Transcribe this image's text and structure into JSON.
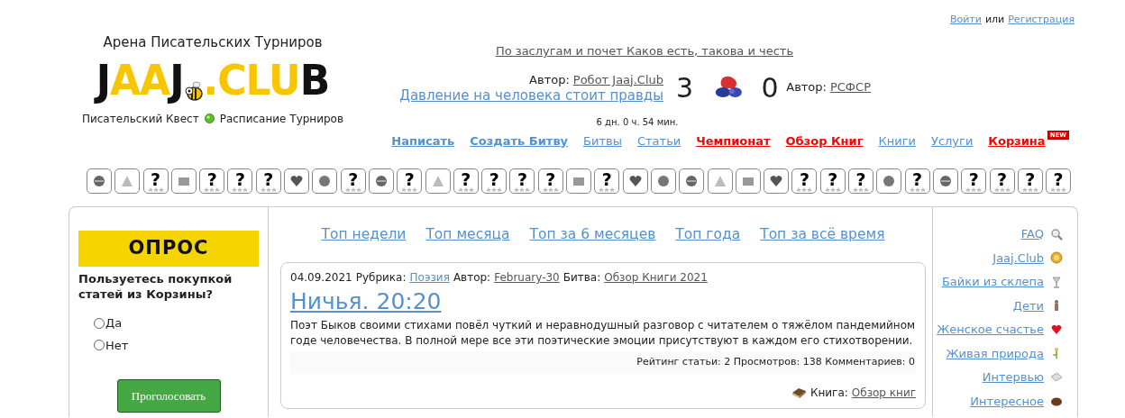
{
  "auth": {
    "login": "Войти",
    "separator": "или",
    "register": "Регистрация"
  },
  "site": {
    "tagline": "Арена Писательских Турниров",
    "logo": [
      {
        "text": "J",
        "color": "#111111"
      },
      {
        "text": "AA",
        "color": "#f7c600"
      },
      {
        "text": "J",
        "color": "#111111"
      },
      {
        "text": ".CLU",
        "color": "#f7c600"
      },
      {
        "text": "B",
        "color": "#111111"
      }
    ],
    "quest": "Писательский Квест",
    "schedule": "Расписание Турниров"
  },
  "battle": {
    "motto": "По заслугам и почет Каков есть, такова и честь",
    "left_author_label": "Автор:",
    "left_author": "Робот Jaaj.Club",
    "title": "Давление на человека стоит правды",
    "left_score": "3",
    "right_score": "0",
    "right_author_label": "Автор:",
    "right_author": "РСФСР",
    "timer": "6 дн. 0 ч. 54 мин."
  },
  "nav": [
    {
      "label": "Написать",
      "kind": "bold"
    },
    {
      "label": "Создать Битву",
      "kind": "bold"
    },
    {
      "label": "Битвы",
      "kind": "plain"
    },
    {
      "label": "Статьи",
      "kind": "plain"
    },
    {
      "label": "Чемпионат",
      "kind": "red"
    },
    {
      "label": "Обзор Книг",
      "kind": "red"
    },
    {
      "label": "Книги",
      "kind": "plain"
    },
    {
      "label": "Услуги",
      "kind": "plain"
    },
    {
      "label": "Корзина",
      "kind": "red",
      "badge": "NEW"
    }
  ],
  "badges": [
    {
      "kind": "item"
    },
    {
      "kind": "item"
    },
    {
      "kind": "unknown",
      "label": "?"
    },
    {
      "kind": "item"
    },
    {
      "kind": "unknown",
      "label": "?"
    },
    {
      "kind": "unknown",
      "label": "?"
    },
    {
      "kind": "unknown",
      "label": "?"
    },
    {
      "kind": "item"
    },
    {
      "kind": "item"
    },
    {
      "kind": "unknown",
      "label": "?"
    },
    {
      "kind": "item"
    },
    {
      "kind": "unknown",
      "label": "?"
    },
    {
      "kind": "item"
    },
    {
      "kind": "unknown",
      "label": "?"
    },
    {
      "kind": "unknown",
      "label": "?"
    },
    {
      "kind": "unknown",
      "label": "?"
    },
    {
      "kind": "unknown",
      "label": "?"
    },
    {
      "kind": "item"
    },
    {
      "kind": "unknown",
      "label": "?"
    },
    {
      "kind": "item"
    },
    {
      "kind": "item"
    },
    {
      "kind": "item"
    },
    {
      "kind": "item"
    },
    {
      "kind": "item"
    },
    {
      "kind": "item"
    },
    {
      "kind": "unknown",
      "label": "?"
    },
    {
      "kind": "unknown",
      "label": "?"
    },
    {
      "kind": "unknown",
      "label": "?"
    },
    {
      "kind": "item"
    },
    {
      "kind": "unknown",
      "label": "?"
    },
    {
      "kind": "item"
    },
    {
      "kind": "unknown",
      "label": "?"
    },
    {
      "kind": "unknown",
      "label": "?"
    },
    {
      "kind": "unknown",
      "label": "?"
    },
    {
      "kind": "unknown",
      "label": "?"
    }
  ],
  "poll": {
    "title": "ОПРОС",
    "question": "Пользуетесь покупкой статей из Корзины?",
    "options": [
      {
        "label": "Да",
        "selected": false
      },
      {
        "label": "Нет",
        "selected": false
      }
    ],
    "button": "Проголосовать"
  },
  "top_tabs": [
    "Топ недели",
    "Топ месяца",
    "Топ за 6 месяцев",
    "Топ года",
    "Топ за всё время"
  ],
  "article": {
    "date": "04.09.2021",
    "rubric_label": "Рубрика:",
    "rubric": "Поэзия",
    "author_label": "Автор:",
    "author": "February-30",
    "battle_label": "Битва:",
    "battle": "Обзор Книги 2021",
    "title": "Ничья. 20:20",
    "excerpt": "Поэт Быков своими стихами повёл чуткий и неравнодушный разговор с читателем о тяжёлом пандемийном годе человечества. В полной мере все эти поэтические эмоции присутствуют в каждом его стихотворении.",
    "stats": "Рейтинг статьи: 2 Просмотров: 138 Комментариев: 0",
    "book_label": "Книга:",
    "book": "Обзор книг"
  },
  "categories": [
    {
      "label": "FAQ",
      "kind": "search"
    },
    {
      "label": "Jaaj.Club",
      "kind": "coin"
    },
    {
      "label": "Байки из склепа",
      "kind": "goblet"
    },
    {
      "label": "Дети",
      "kind": "figure"
    },
    {
      "label": "Женское счастье",
      "kind": "heart"
    },
    {
      "label": "Живая природа",
      "kind": "flower"
    },
    {
      "label": "Интервью",
      "kind": "note"
    },
    {
      "label": "Интересное",
      "kind": "ball"
    }
  ]
}
